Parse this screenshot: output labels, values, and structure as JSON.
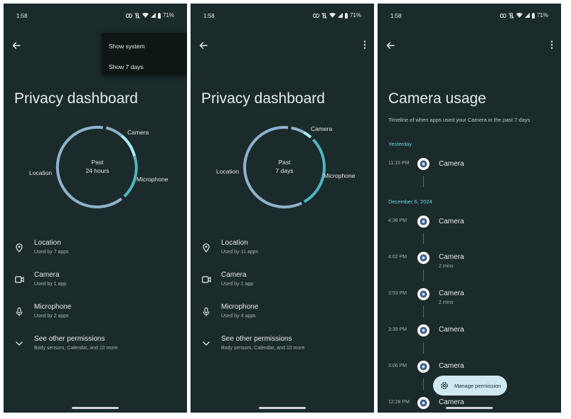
{
  "status": {
    "time": "1:58",
    "battery": "71%"
  },
  "screens": [
    {
      "title": "Privacy dashboard",
      "menu": [
        "Show system",
        "Show 7 days"
      ],
      "chart_center": [
        "Past",
        "24 hours"
      ],
      "chart_labels": {
        "camera": "Camera",
        "microphone": "Microphone",
        "location": "Location"
      },
      "permissions": [
        {
          "name": "Location",
          "sub": "Used by 7 apps",
          "icon": "location-icon"
        },
        {
          "name": "Camera",
          "sub": "Used by 1 app",
          "icon": "camera-icon"
        },
        {
          "name": "Microphone",
          "sub": "Used by 2 apps",
          "icon": "microphone-icon"
        },
        {
          "name": "See other permissions",
          "sub": "Body sensors, Calendar, and 10 more",
          "icon": "chevron-down-icon"
        }
      ]
    },
    {
      "title": "Privacy dashboard",
      "chart_center": [
        "Past",
        "7 days"
      ],
      "chart_labels": {
        "camera": "Camera",
        "microphone": "Microphone",
        "location": "Location"
      },
      "permissions": [
        {
          "name": "Location",
          "sub": "Used by 11 apps",
          "icon": "location-icon"
        },
        {
          "name": "Camera",
          "sub": "Used by 1 app",
          "icon": "camera-icon"
        },
        {
          "name": "Microphone",
          "sub": "Used by 4 apps",
          "icon": "microphone-icon"
        },
        {
          "name": "See other permissions",
          "sub": "Body sensors, Calendar, and 10 more",
          "icon": "chevron-down-icon"
        }
      ]
    },
    {
      "title": "Camera usage",
      "subtitle": "Timeline of when apps used your Camera in the past 7 days",
      "sections": [
        "Yesterday",
        "December 6, 2024"
      ],
      "events": [
        {
          "time": "11:15 PM",
          "app": "Camera",
          "duration": ""
        },
        {
          "time": "4:36 PM",
          "app": "Camera",
          "duration": ""
        },
        {
          "time": "4:02 PM",
          "app": "Camera",
          "duration": "2 mins"
        },
        {
          "time": "3:53 PM",
          "app": "Camera",
          "duration": "2 mins"
        },
        {
          "time": "3:39 PM",
          "app": "Camera",
          "duration": ""
        },
        {
          "time": "3:06 PM",
          "app": "Camera",
          "duration": ""
        },
        {
          "time": "12:28 PM",
          "app": "Camera",
          "duration": ""
        }
      ],
      "fab_label": "Manage permission"
    }
  ],
  "colors": {
    "background": "#1b2a2b",
    "location": "#8fb3cc",
    "camera": "#a8ecf6",
    "microphone": "#4fb6c0",
    "accent": "#67d3e0",
    "fab": "#cfe9f1"
  }
}
